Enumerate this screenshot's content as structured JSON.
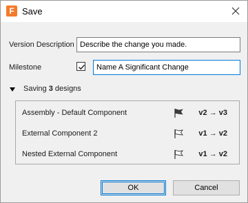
{
  "window": {
    "title": "Save",
    "app_icon_letter": "F",
    "app_icon_color": "#f37b2b"
  },
  "form": {
    "version_description_label": "Version Description",
    "version_description_value": "Describe the change you made.",
    "milestone_label": "Milestone",
    "milestone_checked": true,
    "milestone_value": "Name A Significant Change"
  },
  "saving": {
    "prefix": "Saving ",
    "count": "3",
    "suffix": " designs",
    "expanded": true
  },
  "designs": [
    {
      "name": "Assembly - Default Component",
      "flag": "filled-flag-icon",
      "version": "v2 → v3"
    },
    {
      "name": "External Component 2",
      "flag": "outline-flag-icon",
      "version": "v1 → v2"
    },
    {
      "name": "Nested External Component",
      "flag": "outline-flag-icon",
      "version": "v1 → v2"
    }
  ],
  "buttons": {
    "ok_label": "OK",
    "cancel_label": "Cancel"
  },
  "colors": {
    "accent": "#0078d7",
    "dialog_bg": "#f0f0f0"
  }
}
